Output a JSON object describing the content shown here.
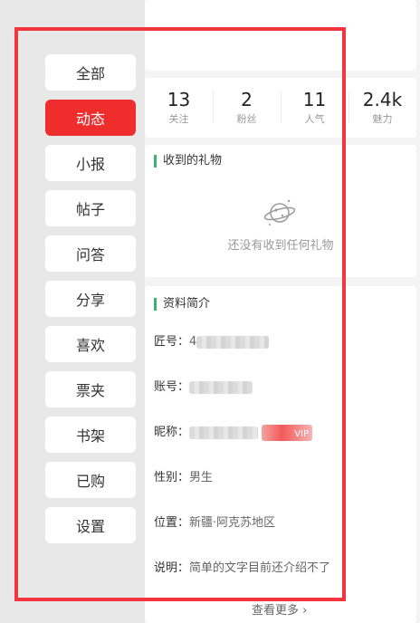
{
  "sidebar": {
    "items": [
      {
        "label": "全部"
      },
      {
        "label": "动态"
      },
      {
        "label": "小报"
      },
      {
        "label": "帖子"
      },
      {
        "label": "问答"
      },
      {
        "label": "分享"
      },
      {
        "label": "喜欢"
      },
      {
        "label": "票夹"
      },
      {
        "label": "书架"
      },
      {
        "label": "已购"
      },
      {
        "label": "设置"
      }
    ],
    "active_index": 1
  },
  "stats": [
    {
      "value": "13",
      "label": "关注"
    },
    {
      "value": "2",
      "label": "粉丝"
    },
    {
      "value": "11",
      "label": "人气"
    },
    {
      "value": "2.4k",
      "label": "魅力"
    }
  ],
  "gifts": {
    "title": "收到的礼物",
    "empty_text": "还没有收到任何礼物"
  },
  "profile": {
    "title": "资料简介",
    "fields": [
      {
        "label": "匠号：",
        "value": "4"
      },
      {
        "label": "账号：",
        "value": ""
      },
      {
        "label": "昵称：",
        "value": "",
        "badge": "VIP"
      },
      {
        "label": "性别：",
        "value": "男生"
      },
      {
        "label": "位置：",
        "value": "新疆·阿克苏地区"
      },
      {
        "label": "说明：",
        "value": "简单的文字目前还介绍不了"
      }
    ],
    "see_more": "查看更多 ›"
  },
  "colors": {
    "active_red": "#f02d2d",
    "title_bar_green": "#3cb371",
    "highlight_border": "#f2353f"
  }
}
